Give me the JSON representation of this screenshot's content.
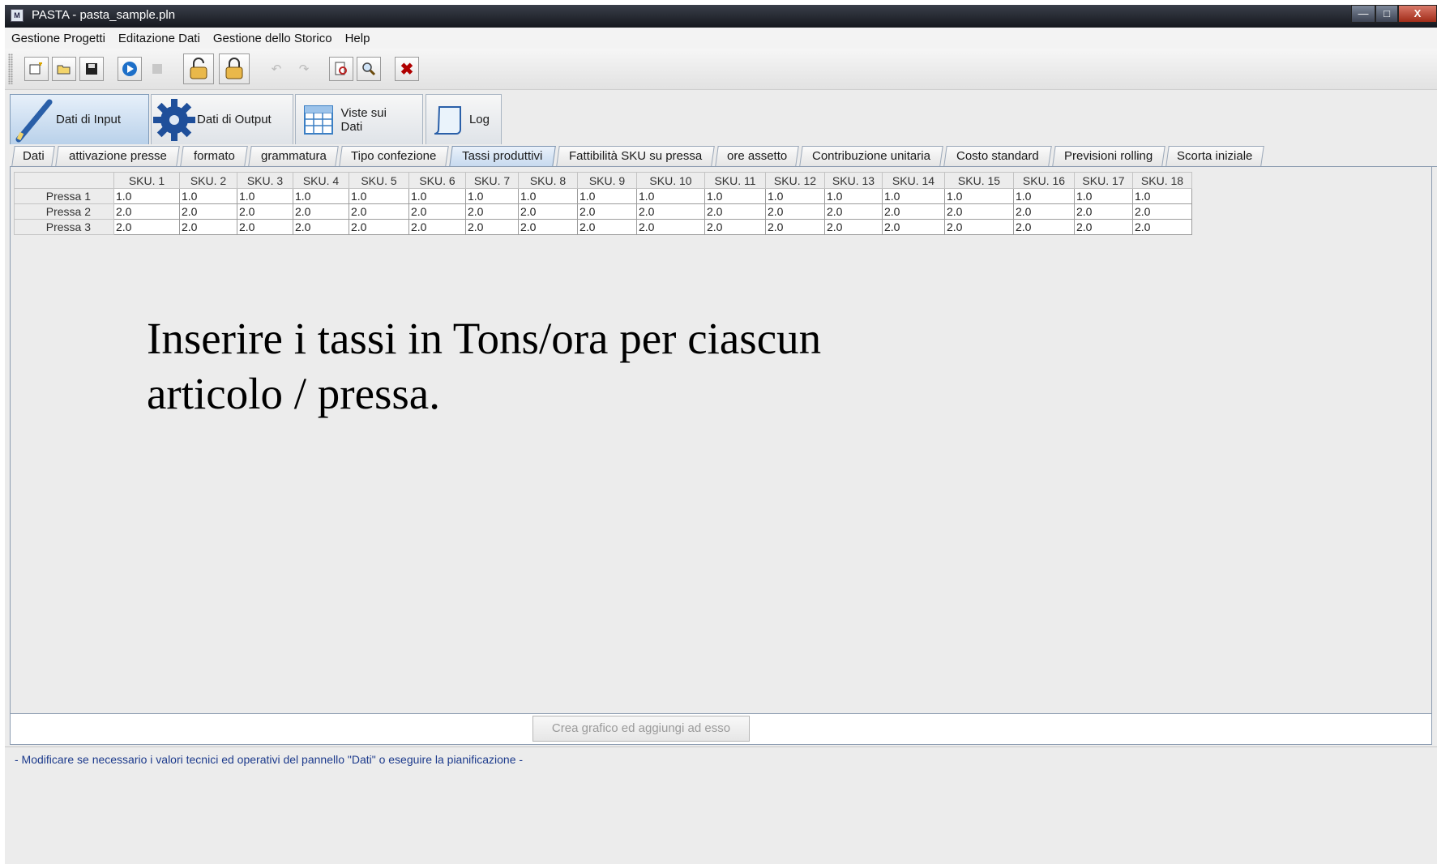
{
  "window": {
    "title": "PASTA - pasta_sample.pln"
  },
  "menu": [
    "Gestione Progetti",
    "Editazione Dati",
    "Gestione dello Storico",
    "Help"
  ],
  "toolbar": {
    "buttons": [
      "new-file-icon",
      "open-folder-icon",
      "save-icon",
      "run-icon",
      "stop-icon",
      "unlock-icon",
      "lock-icon",
      "undo-icon",
      "redo-icon",
      "preview-icon",
      "zoom-icon",
      "delete-icon"
    ]
  },
  "main_tabs": [
    {
      "label": "Dati di Input",
      "icon": "pen-icon",
      "active": true
    },
    {
      "label": "Dati di Output",
      "icon": "gear-icon",
      "active": false
    },
    {
      "label": "Viste sui Dati",
      "icon": "grid-icon",
      "active": false
    },
    {
      "label": "Log",
      "icon": "scroll-icon",
      "active": false
    }
  ],
  "sub_tabs": [
    {
      "label": "Dati",
      "active": false
    },
    {
      "label": "attivazione presse",
      "active": false
    },
    {
      "label": "formato",
      "active": false
    },
    {
      "label": "grammatura",
      "active": false
    },
    {
      "label": "Tipo confezione",
      "active": false
    },
    {
      "label": "Tassi produttivi",
      "active": true
    },
    {
      "label": "Fattibilità SKU su pressa",
      "active": false
    },
    {
      "label": "ore assetto",
      "active": false
    },
    {
      "label": "Contribuzione unitaria",
      "active": false
    },
    {
      "label": "Costo standard",
      "active": false
    },
    {
      "label": "Previsioni rolling",
      "active": false
    },
    {
      "label": "Scorta iniziale",
      "active": false
    }
  ],
  "table": {
    "columns": [
      "SKU. 1",
      "SKU. 2",
      "SKU. 3",
      "SKU. 4",
      "SKU. 5",
      "SKU. 6",
      "SKU. 7",
      "SKU. 8",
      "SKU. 9",
      "SKU. 10",
      "SKU. 11",
      "SKU. 12",
      "SKU. 13",
      "SKU. 14",
      "SKU. 15",
      "SKU. 16",
      "SKU. 17",
      "SKU. 18"
    ],
    "rows": [
      {
        "label": "Pressa 1",
        "values": [
          "1.0",
          "1.0",
          "1.0",
          "1.0",
          "1.0",
          "1.0",
          "1.0",
          "1.0",
          "1.0",
          "1.0",
          "1.0",
          "1.0",
          "1.0",
          "1.0",
          "1.0",
          "1.0",
          "1.0",
          "1.0"
        ]
      },
      {
        "label": "Pressa 2",
        "values": [
          "2.0",
          "2.0",
          "2.0",
          "2.0",
          "2.0",
          "2.0",
          "2.0",
          "2.0",
          "2.0",
          "2.0",
          "2.0",
          "2.0",
          "2.0",
          "2.0",
          "2.0",
          "2.0",
          "2.0",
          "2.0"
        ]
      },
      {
        "label": "Pressa 3",
        "values": [
          "2.0",
          "2.0",
          "2.0",
          "2.0",
          "2.0",
          "2.0",
          "2.0",
          "2.0",
          "2.0",
          "2.0",
          "2.0",
          "2.0",
          "2.0",
          "2.0",
          "2.0",
          "2.0",
          "2.0",
          "2.0"
        ]
      }
    ]
  },
  "annotation": {
    "line1": "Inserire i tassi in Tons/ora per ciascun",
    "line2": "articolo / pressa."
  },
  "bottom": {
    "chart_button": "Crea grafico ed aggiungi ad esso"
  },
  "status": {
    "text": "- Modificare se necessario i valori tecnici ed operativi del pannello \"Dati\" o eseguire la pianificazione -"
  }
}
